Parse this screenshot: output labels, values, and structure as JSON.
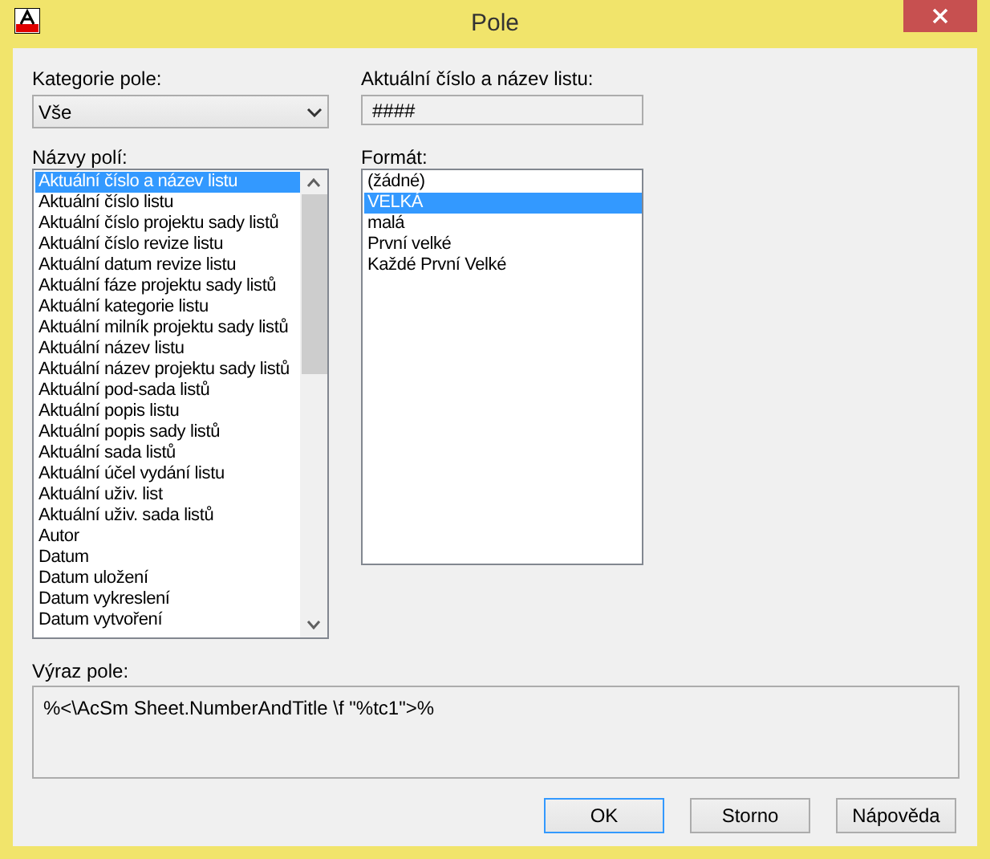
{
  "window": {
    "title": "Pole"
  },
  "category": {
    "label": "Kategorie pole:",
    "value": "Vše"
  },
  "field_names": {
    "label": "Názvy polí:",
    "items": [
      {
        "label": "Aktuální číslo a název listu",
        "selected": true
      },
      {
        "label": "Aktuální číslo listu",
        "selected": false
      },
      {
        "label": "Aktuální číslo projektu sady listů",
        "selected": false
      },
      {
        "label": "Aktuální číslo revize listu",
        "selected": false
      },
      {
        "label": "Aktuální datum revize listu",
        "selected": false
      },
      {
        "label": "Aktuální fáze projektu sady listů",
        "selected": false
      },
      {
        "label": "Aktuální kategorie listu",
        "selected": false
      },
      {
        "label": "Aktuální milník projektu sady listů",
        "selected": false
      },
      {
        "label": "Aktuální název listu",
        "selected": false
      },
      {
        "label": "Aktuální název projektu sady listů",
        "selected": false
      },
      {
        "label": "Aktuální pod-sada listů",
        "selected": false
      },
      {
        "label": "Aktuální popis listu",
        "selected": false
      },
      {
        "label": "Aktuální popis sady listů",
        "selected": false
      },
      {
        "label": "Aktuální sada listů",
        "selected": false
      },
      {
        "label": "Aktuální účel vydání listu",
        "selected": false
      },
      {
        "label": "Aktuální uživ. list",
        "selected": false
      },
      {
        "label": "Aktuální uživ. sada listů",
        "selected": false
      },
      {
        "label": "Autor",
        "selected": false
      },
      {
        "label": "Datum",
        "selected": false
      },
      {
        "label": "Datum uložení",
        "selected": false
      },
      {
        "label": "Datum vykreslení",
        "selected": false
      },
      {
        "label": "Datum vytvoření",
        "selected": false
      }
    ]
  },
  "value": {
    "label": "Aktuální číslo a název listu:",
    "text": "####"
  },
  "format": {
    "label": "Formát:",
    "items": [
      {
        "label": "(žádné)",
        "selected": false
      },
      {
        "label": "VELKÁ",
        "selected": true
      },
      {
        "label": "malá",
        "selected": false
      },
      {
        "label": "První velké",
        "selected": false
      },
      {
        "label": "Každé První Velké",
        "selected": false
      }
    ]
  },
  "expression": {
    "label": "Výraz pole:",
    "text": "%<\\AcSm Sheet.NumberAndTitle \\f \"%tc1\">%"
  },
  "buttons": [
    {
      "label": "OK",
      "default": true
    },
    {
      "label": "Storno",
      "default": false
    },
    {
      "label": "Nápověda",
      "default": false
    }
  ]
}
